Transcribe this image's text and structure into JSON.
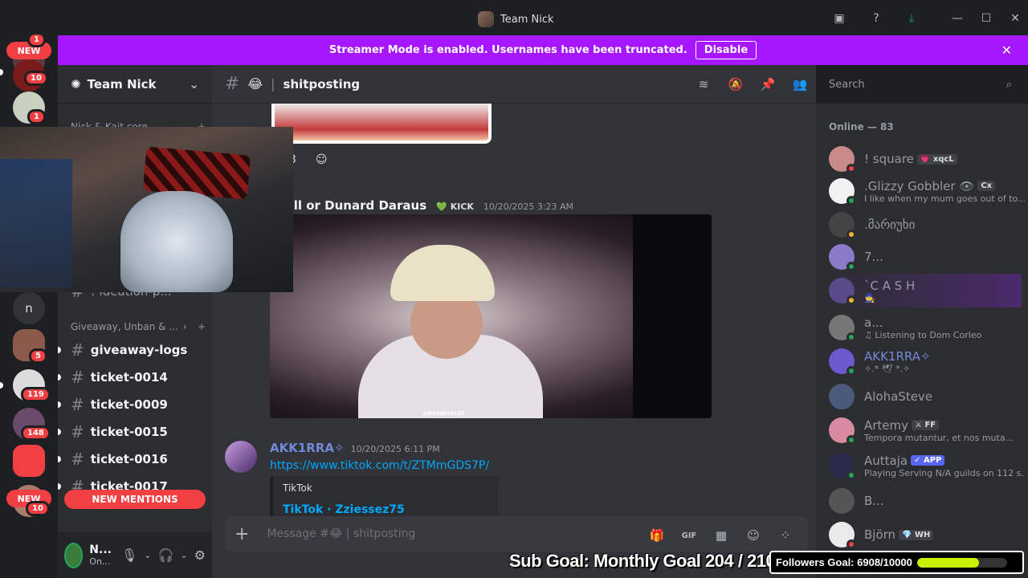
{
  "window": {
    "title": "Team Nick"
  },
  "banner": {
    "text": "Streamer Mode is enabled. Usernames have been truncated.",
    "button": "Disable"
  },
  "rail": {
    "new_top": "NEW",
    "new_bottom": "NEW",
    "badges": [
      "1",
      "10",
      "1",
      "5",
      "119",
      "148",
      "10"
    ],
    "letter": "n"
  },
  "server": {
    "name": "Team Nick"
  },
  "sidebar": {
    "category1": "Nick & Kait core",
    "partial_channel": "! ideation-p...",
    "category2": "Giveaway, Unban & ...",
    "channels": [
      "giveaway-logs",
      "ticket-0014",
      "ticket-0009",
      "ticket-0015",
      "ticket-0016",
      "ticket-0017"
    ],
    "new_mentions": "NEW MENTIONS"
  },
  "user": {
    "name": "N...",
    "status": "On..."
  },
  "channel": {
    "name": "shitposting",
    "emoji": "😂"
  },
  "search": {
    "placeholder": "Search"
  },
  "messages": {
    "reaction_count": "3",
    "msg1": {
      "author": "chell or Dunard Daraus",
      "tag": "KICK",
      "timestamp": "10/20/2025 3:23 AM",
      "watermark": "@NICKWICKLEE"
    },
    "msg2": {
      "author": "AKK1RRA✧",
      "timestamp": "10/20/2025 6:11 PM",
      "link": "https://www.tiktok.com/t/ZTMmGDS7P/",
      "embed_provider": "TikTok",
      "embed_title": "TikTok · Zziessez75"
    }
  },
  "composer": {
    "placeholder": "Message #😂 | shitposting"
  },
  "members": {
    "header": "Online — 83",
    "list": [
      {
        "name": "! square",
        "tag": "💗 xqcL",
        "sub": "",
        "color": "#c98a8a",
        "status": "#f23f43"
      },
      {
        "name": ".Glizzy Gobbler 👁",
        "tag": "Cx",
        "sub": "I like when my mum goes out of to...",
        "color": "#f2f2f2",
        "status": "#23a55a"
      },
      {
        "name": ".მარიუხი",
        "tag": "",
        "sub": "",
        "color": "#444",
        "status": "#f0b232"
      },
      {
        "name": "7...",
        "tag": "",
        "sub": "",
        "color": "#8a7ac8",
        "status": "#23a55a"
      },
      {
        "name": "`C A S H",
        "tag": "",
        "sub": "🧙",
        "color": "#5a4a8a",
        "status": "#f0b232"
      },
      {
        "name": "a...",
        "tag": "",
        "sub": "♫ Listening to Dom Corleo",
        "color": "#777",
        "status": "#23a55a"
      },
      {
        "name": "AKK1RRA✧",
        "tag": "",
        "sub": "✧.* 🕊 *.✧",
        "color": "#6a5acd",
        "status": "#23a55a"
      },
      {
        "name": "AlohaSteve",
        "tag": "",
        "sub": "",
        "color": "#4a5a7a",
        "status": ""
      },
      {
        "name": "Artemy",
        "tag": "⚔ FF",
        "sub": "Tempora mutantur, et nos muta...",
        "color": "#d88aa0",
        "status": "#23a55a"
      },
      {
        "name": "Auttaja",
        "tag": "✓ APP",
        "sub": "Playing Serving N/A guilds on 112 s...",
        "color": "#2a2a4a",
        "status": "#23a55a"
      },
      {
        "name": "B...",
        "tag": "",
        "sub": "",
        "color": "#555",
        "status": ""
      },
      {
        "name": "Björn",
        "tag": "💎 WH",
        "sub": "",
        "color": "#eaeaea",
        "status": "#f23f43"
      }
    ]
  },
  "overlay": {
    "subgoal": "Sub Goal: Monthly Goal  204 / 210",
    "followers": "Followers Goal: 6908/10000",
    "followers_fraction": 0.6908
  }
}
